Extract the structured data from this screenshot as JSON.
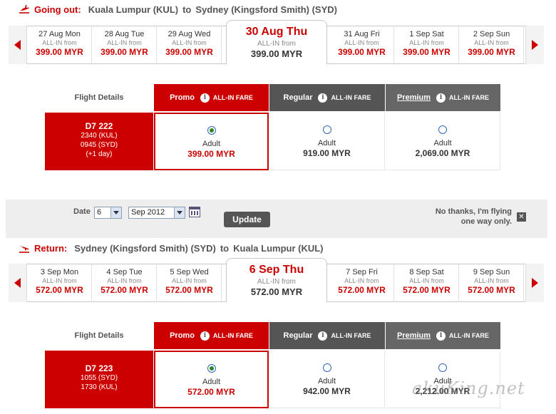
{
  "outbound": {
    "direction": "Going out:",
    "from": "Kuala Lumpur (KUL)",
    "to_word": "to",
    "to": "Sydney (Kingsford Smith) (SYD)",
    "dates": [
      {
        "date": "27 Aug Mon",
        "all_in": "ALL-IN from",
        "price": "399.00 MYR"
      },
      {
        "date": "28 Aug Tue",
        "all_in": "ALL-IN from",
        "price": "399.00 MYR"
      },
      {
        "date": "29 Aug Wed",
        "all_in": "ALL-IN from",
        "price": "399.00 MYR"
      },
      {
        "date": "30 Aug Thu",
        "all_in": "ALL-IN from",
        "price": "399.00 MYR",
        "selected": true
      },
      {
        "date": "31 Aug Fri",
        "all_in": "ALL-IN from",
        "price": "399.00 MYR"
      },
      {
        "date": "1 Sep Sat",
        "all_in": "ALL-IN from",
        "price": "399.00 MYR"
      },
      {
        "date": "2 Sep Sun",
        "all_in": "ALL-IN from",
        "price": "399.00 MYR"
      }
    ],
    "flight": {
      "number": "D7  222",
      "depart": "2340  (KUL)",
      "arrive": "0945  (SYD)",
      "note": "(+1 day)"
    },
    "fares": [
      {
        "pax": "Adult",
        "price": "399.00 MYR",
        "selected": true
      },
      {
        "pax": "Adult",
        "price": "919.00 MYR",
        "selected": false
      },
      {
        "pax": "Adult",
        "price": "2,069.00 MYR",
        "selected": false
      }
    ]
  },
  "return": {
    "direction": "Return:",
    "from": "Sydney (Kingsford Smith) (SYD)",
    "to_word": "to",
    "to": "Kuala Lumpur (KUL)",
    "dates": [
      {
        "date": "3 Sep Mon",
        "all_in": "ALL-IN from",
        "price": "572.00 MYR"
      },
      {
        "date": "4 Sep Tue",
        "all_in": "ALL-IN from",
        "price": "572.00 MYR"
      },
      {
        "date": "5 Sep Wed",
        "all_in": "ALL-IN from",
        "price": "572.00 MYR"
      },
      {
        "date": "6 Sep Thu",
        "all_in": "ALL-IN from",
        "price": "572.00 MYR",
        "selected": true
      },
      {
        "date": "7 Sep Fri",
        "all_in": "ALL-IN from",
        "price": "572.00 MYR"
      },
      {
        "date": "8 Sep Sat",
        "all_in": "ALL-IN from",
        "price": "572.00 MYR"
      },
      {
        "date": "9 Sep Sun",
        "all_in": "ALL-IN from",
        "price": "572.00 MYR"
      }
    ],
    "flight": {
      "number": "D7  223",
      "depart": "1055  (SYD)",
      "arrive": "1730  (KUL)"
    },
    "fares": [
      {
        "pax": "Adult",
        "price": "572.00 MYR",
        "selected": true
      },
      {
        "pax": "Adult",
        "price": "942.00 MYR",
        "selected": false
      },
      {
        "pax": "Adult",
        "price": "2,212.00 MYR",
        "selected": false
      }
    ]
  },
  "fare_table": {
    "flight_details": "Flight Details",
    "promo": "Promo",
    "regular": "Regular",
    "premium": "Premium",
    "all_in_fare": "ALL-IN FARE"
  },
  "date_bar": {
    "date_label": "Date",
    "day_value": "6",
    "month_value": "Sep 2012",
    "update_label": "Update",
    "oneway_line1": "No thanks, I'm flying",
    "oneway_line2": "one way only.",
    "close_glyph": "✕"
  },
  "watermark": "akuKing.net",
  "colors": {
    "brand_red": "#cc0000",
    "header_gray": "#555555"
  }
}
